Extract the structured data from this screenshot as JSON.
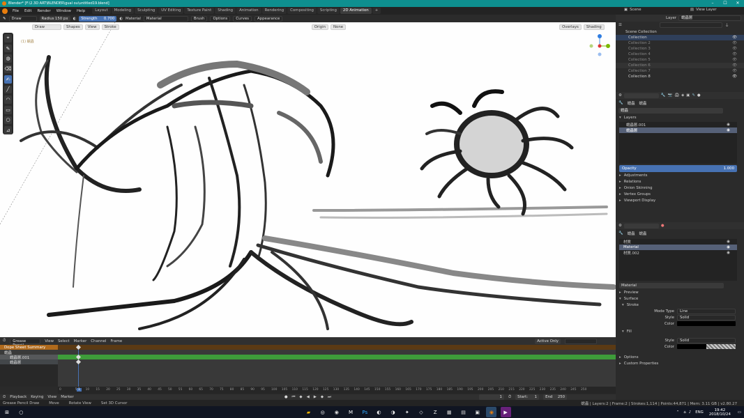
{
  "window": {
    "title": "Blender* [F:\\2.3D ART\\BLENDER\\gual ou\\untitled19.blend]"
  },
  "menu": [
    "File",
    "Edit",
    "Render",
    "Window",
    "Help"
  ],
  "workspaces": [
    "Layout",
    "Modeling",
    "Sculpting",
    "UV Editing",
    "Texture Paint",
    "Shading",
    "Animation",
    "Rendering",
    "Compositing",
    "Scripting",
    "2D Animation"
  ],
  "active_workspace": "2D Animation",
  "scene": {
    "label": "Scene",
    "view_layer": "View Layer"
  },
  "tool_header": {
    "mode": "Draw",
    "radius_label": "Radius",
    "radius_value": "150 px",
    "strength_label": "Strength",
    "strength_value": "0.700",
    "material_label": "Material",
    "material_value": "Material",
    "brush": "Brush",
    "options": "Options",
    "curves": "Curves",
    "appearance": "Appearance",
    "layer_label": "Layer",
    "layer_value": "蠕蟲層"
  },
  "viewport_header": {
    "mode": "Draw",
    "shapes": "Shapes",
    "view": "View",
    "stroke": "Stroke",
    "origin": "Origin",
    "none": "None",
    "overlays": "Overlays",
    "shading": "Shading"
  },
  "viewport": {
    "object_label": "(1) 蠕蟲"
  },
  "outliner": {
    "root": "Scene Collection",
    "items": [
      "Collection",
      "Collection 2",
      "Collection 3",
      "Collection 4",
      "Collection 5",
      "Collection 6",
      "Collection 7",
      "Collection 8"
    ]
  },
  "properties_data": {
    "tab_name": "蠕蟲",
    "tab_name2": "蠕蟲",
    "data_name": "蠕蟲",
    "layers_header": "Layers",
    "layers": [
      "蠕蟲層.001",
      "蠕蟲層"
    ],
    "opacity_label": "Opacity",
    "opacity_value": "1.000",
    "sections": [
      "Adjustments",
      "Relations",
      "Onion Skinning",
      "Vertex Groups",
      "Viewport Display"
    ]
  },
  "properties_material": {
    "tab_name": "蠕蟲",
    "tab_name2": "蠕蟲",
    "materials": [
      "材質",
      "Material",
      "材質.002"
    ],
    "material_field": "Material",
    "sections": [
      "Preview",
      "Surface"
    ],
    "stroke": {
      "header": "Stroke",
      "mode_type_label": "Mode Type",
      "mode_type": "Line",
      "style_label": "Style",
      "style": "Solid",
      "color_label": "Color"
    },
    "fill": {
      "header": "Fill",
      "style_label": "Style",
      "style": "Solid",
      "color_label": "Color"
    },
    "options": "Options",
    "custom": "Custom Properties"
  },
  "dope": {
    "editor": "Grease Pencil",
    "menus": [
      "View",
      "Select",
      "Marker",
      "Channel",
      "Frame"
    ],
    "active_only": "Active Only",
    "summary": "Dope Sheet Summary",
    "object": "蠕蟲",
    "layers": [
      "蠕蟲層.001",
      "蠕蟲層"
    ],
    "ruler": [
      "0",
      "1",
      "5",
      "10",
      "15",
      "20",
      "25",
      "30",
      "35",
      "40",
      "45",
      "50",
      "55",
      "60",
      "65",
      "70",
      "75",
      "80",
      "85",
      "90",
      "95",
      "100",
      "105",
      "110",
      "115",
      "120",
      "125",
      "130",
      "135",
      "140",
      "145",
      "150",
      "155",
      "160",
      "165",
      "170",
      "175",
      "180",
      "185",
      "190",
      "195",
      "200",
      "205",
      "210",
      "215",
      "220",
      "225",
      "230",
      "235",
      "240",
      "245",
      "250"
    ],
    "current_frame": "1"
  },
  "timeline": {
    "menus": [
      "Playback",
      "Keying",
      "View",
      "Marker"
    ],
    "frame": "1",
    "start_label": "Start:",
    "start": "1",
    "end_label": "End",
    "end": "250"
  },
  "status": {
    "left": [
      "Grease Pencil Draw",
      "Move",
      "Rotate View",
      "Set 3D Cursor"
    ],
    "right": "蠕蟲 | Layers:2 | Frame:2 | Strokes:1,114 | Points:44,871 | Mem: 3.11 GB | v2.80.27"
  },
  "taskbar": {
    "lang": "ENG",
    "time": "19:42",
    "date": "2018/10/24",
    "icons": [
      "file-explorer-icon",
      "steam-icon",
      "chrome-icon",
      "m-icon",
      "photoshop-icon",
      "app6-icon",
      "app7-icon",
      "app8-icon",
      "app9-icon",
      "zbrush-icon",
      "app11-icon",
      "app12-icon",
      "app13-icon",
      "blender-icon",
      "visual-studio-icon"
    ]
  }
}
